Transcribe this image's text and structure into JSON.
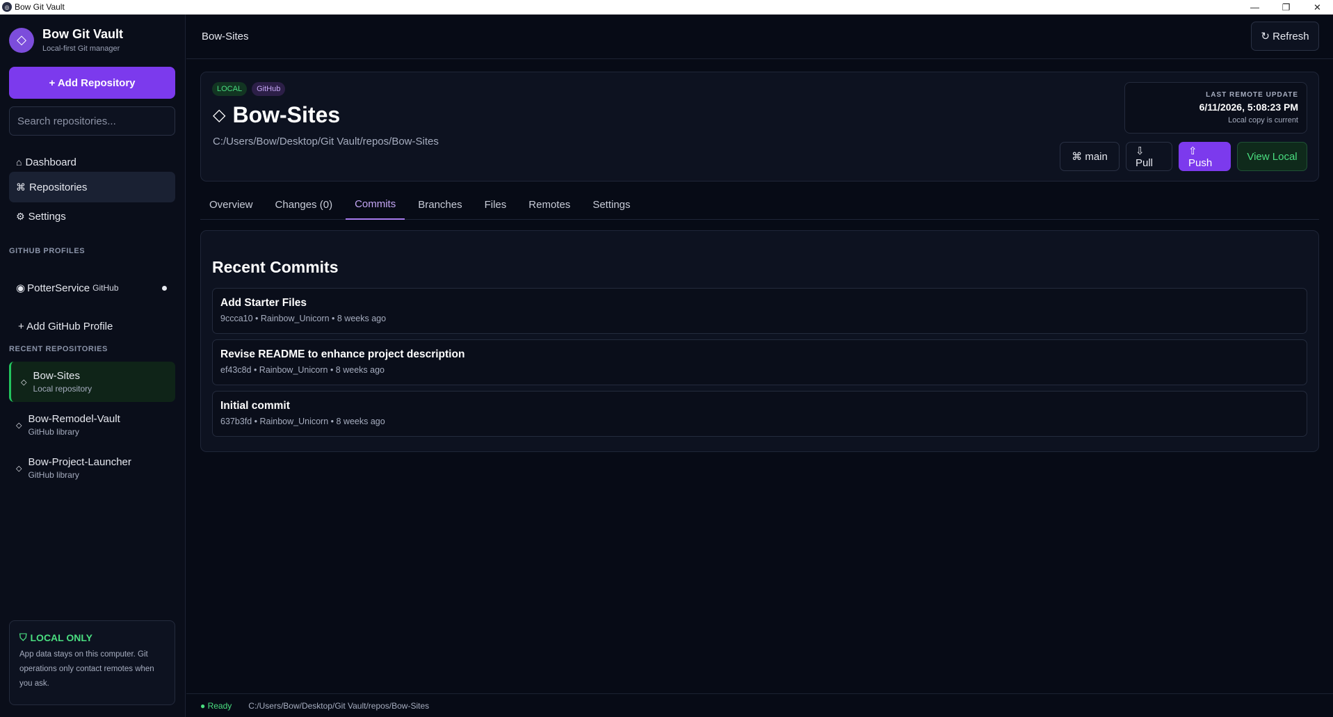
{
  "window": {
    "title": "Bow Git Vault",
    "controls": [
      "—",
      "❐",
      "✕"
    ]
  },
  "brand": {
    "title": "Bow Git Vault",
    "subtitle": "Local-first Git manager",
    "logo_icon": "◇"
  },
  "sidebar": {
    "add_repo_label": "+ Add Repository",
    "search_placeholder": "Search repositories...",
    "nav": [
      {
        "icon": "⌂",
        "label": "Dashboard"
      },
      {
        "icon": "⌘",
        "label": "Repositories"
      },
      {
        "icon": "⚙",
        "label": "Settings"
      }
    ],
    "github_profiles_label": "GITHUB PROFILES",
    "profile": {
      "icon": "◉",
      "name": "PotterService",
      "tag": "GitHub"
    },
    "add_profile_label": "+ Add GitHub Profile",
    "recent_label": "RECENT REPOSITORIES",
    "recent": [
      {
        "icon": "◇",
        "name": "Bow-Sites",
        "sub": "Local repository"
      },
      {
        "icon": "◇",
        "name": "Bow-Remodel-Vault",
        "sub": "GitHub library"
      },
      {
        "icon": "◇",
        "name": "Bow-Project-Launcher",
        "sub": "GitHub library"
      }
    ],
    "local_card": {
      "icon": "⛉",
      "title": "LOCAL ONLY",
      "body": "App data stays on this computer. Git operations only contact remotes when you ask."
    }
  },
  "header": {
    "breadcrumb": "Bow-Sites",
    "refresh_label": "↻ Refresh"
  },
  "repo": {
    "badges": [
      "LOCAL",
      "GitHub"
    ],
    "icon": "◇",
    "name": "Bow-Sites",
    "path": "C:/Users/Bow/Desktop/Git Vault/repos/Bow-Sites",
    "remote": {
      "label": "LAST REMOTE UPDATE",
      "time": "6/11/2026, 5:08:23 PM",
      "sub": "Local copy is current"
    },
    "actions": {
      "branch": "⌘ main",
      "pull": "⇩ Pull",
      "push": "⇧ Push",
      "view": "View Local"
    }
  },
  "tabs": [
    "Overview",
    "Changes (0)",
    "Commits",
    "Branches",
    "Files",
    "Remotes",
    "Settings"
  ],
  "active_tab": "Commits",
  "commits": {
    "title": "Recent Commits",
    "items": [
      {
        "message": "Add Starter Files",
        "meta": "9ccca10 • Rainbow_Unicorn • 8 weeks ago"
      },
      {
        "message": "Revise README to enhance project description",
        "meta": "ef43c8d • Rainbow_Unicorn • 8 weeks ago"
      },
      {
        "message": "Initial commit",
        "meta": "637b3fd • Rainbow_Unicorn • 8 weeks ago"
      }
    ]
  },
  "status": {
    "state": "● Ready",
    "path": "C:/Users/Bow/Desktop/Git Vault/repos/Bow-Sites"
  },
  "colors": {
    "accent": "#7c3aed",
    "success": "#4ade80",
    "background": "#070b16"
  }
}
